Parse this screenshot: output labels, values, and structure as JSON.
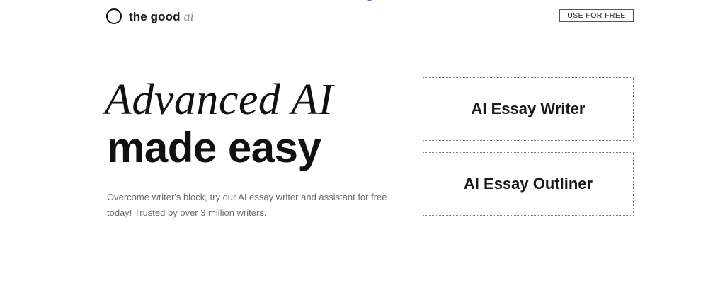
{
  "header": {
    "logo_word": "the good",
    "logo_ai": "ai",
    "cta_label": "USE FOR FREE"
  },
  "hero": {
    "headline_line1": "Advanced AI",
    "headline_line2": "made easy",
    "subtitle": "Overcome writer's block, try our AI essay writer and assistant for free today! Trusted by over 3 million writers."
  },
  "tools": [
    {
      "label": "AI Essay Writer"
    },
    {
      "label": "AI Essay Outliner"
    }
  ],
  "colors": {
    "text": "#111111",
    "muted": "#6b6b6b",
    "logo_ai": "#8a8a8a",
    "background": "#ffffff"
  }
}
